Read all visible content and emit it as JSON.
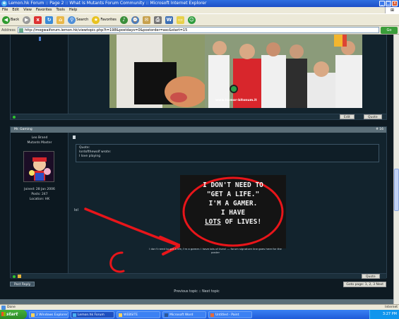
{
  "window": {
    "title": "Lemon.hk Forum :: Page 2 :: What Is Mutants Forum Community :: Microsoft Internet Explorer",
    "buttons": [
      "_",
      "□",
      "x"
    ]
  },
  "menu": [
    "File",
    "Edit",
    "View",
    "Favorites",
    "Tools",
    "Help"
  ],
  "toolbar": {
    "back": "Back",
    "search": "Search",
    "favorites": "Favorites"
  },
  "address": {
    "label": "Address",
    "url": "http://mogwaiforum.lemon.hk/viewtopic.php?t=198&postdays=0&postorder=asc&start=15",
    "go": "Go"
  },
  "post1": {
    "watermark": "www.humor-bitonum.it",
    "edit_button": "Edit",
    "quote_button": "Quote"
  },
  "post2": {
    "header": "Mr. Gaming",
    "date": "# 16",
    "poster_name": "Leo Brand",
    "poster_rank": "Mutants Master",
    "poster_info_1": "Joined: 28 Jan 2006",
    "poster_info_2": "Posts: 247",
    "poster_info_3": "Location: HK",
    "quote_label": "Quote:",
    "quote_text": "lordofthewolf wrote:",
    "quote_text2": "I love playing",
    "reply_text": "lol",
    "gamer_lines": [
      "I DON'T NEED TO",
      "\"GET A LIFE.\"",
      "I'M A GAMER.",
      "I HAVE",
      "LOTS",
      "OF LIVES!"
    ],
    "signature": "I don't need to get a life, I'm a gamer. I have lots of lives! — forum signature line goes here for the poster",
    "quote_button": "Quote"
  },
  "post_reply_button": "Post Reply",
  "pagination": "Goto page: 1, 2, 3  Next",
  "nav_links": "Previous topic :: Next topic",
  "status": {
    "text": "Done",
    "zone": "Internet"
  },
  "taskbar": {
    "start": "start",
    "tasks": [
      "2 Windows Explorer",
      "Lemon.hk Forum",
      "WEBSITE",
      "Microsoft Word",
      "Untitled - Paint"
    ],
    "clock": "3:27 PM"
  }
}
